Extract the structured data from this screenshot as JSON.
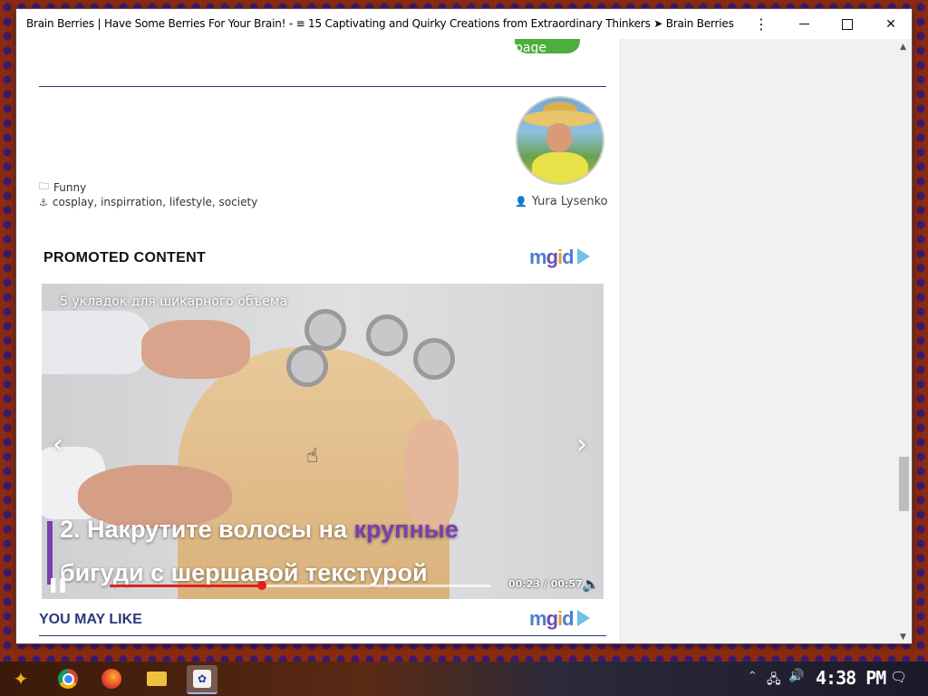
{
  "window": {
    "title": "Brain Berries | Have Some Berries For Your Brain! - ≡ 15 Captivating and Quirky Creations from Extraordinary Thinkers ➤ Brain Berries",
    "menu_glyph": "⋮",
    "minimize_label": "",
    "close_glyph": "✕"
  },
  "article": {
    "next_button": "Next page",
    "category": "Funny",
    "tags": "cosplay, inspirration, lifestyle, society",
    "author": "Yura Lysenko"
  },
  "promoted": {
    "heading": "PROMOTED CONTENT",
    "mgid": "mgid",
    "video": {
      "overlay_title": "5 укладок для шикарного объема",
      "caption_line1_a": "2. Накрутите волосы на ",
      "caption_line1_b": "крупные",
      "caption_line2": "бигуди с шершавой текстурой",
      "current_time": "00:23",
      "separator": " / ",
      "duration": "00:57",
      "progress_fraction": 0.4,
      "arrow_left": "‹",
      "arrow_right": "›",
      "pause_glyph": "❚❚",
      "volume_glyph": "🔈"
    }
  },
  "you_may_like": {
    "heading": "YOU MAY LIKE",
    "mgid": "mgid"
  },
  "taskbar": {
    "clock": "4:38 PM",
    "tray_up": "^",
    "network_glyph": "🖧",
    "volume_glyph": "🔊",
    "notify_glyph": "🗨",
    "start_glyph": "✦",
    "browser_glyph": "✿"
  },
  "colors": {
    "next_button": "#4cae3c",
    "accent_purple": "#7a3fb0",
    "progress_red": "#e02020",
    "heading_navy": "#2b3a7a"
  },
  "icons": {
    "category": "folder-icon",
    "tags": "anchor-icon",
    "author": "user-icon"
  }
}
